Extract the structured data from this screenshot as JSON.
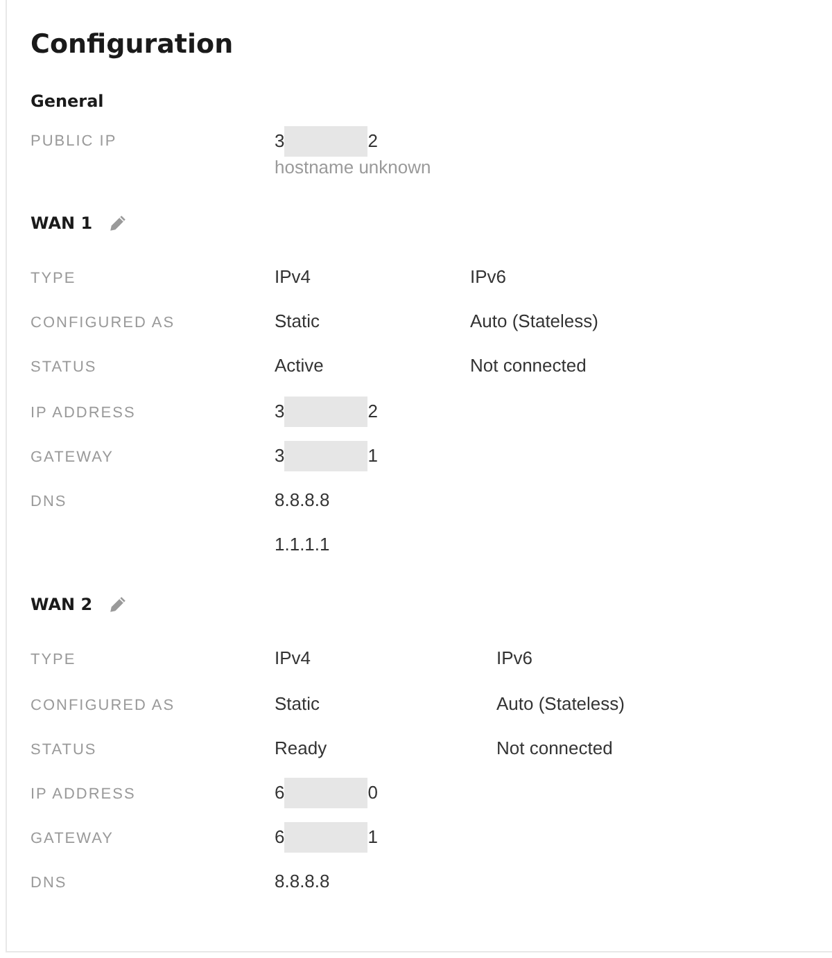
{
  "title": "Configuration",
  "general": {
    "heading": "General",
    "rows": [
      {
        "label": "PUBLIC IP",
        "cells": [
          {
            "kind": "redacted",
            "start": "3",
            "end": "2"
          }
        ],
        "note": "hostname unknown"
      }
    ]
  },
  "wans": [
    {
      "heading": "WAN 1",
      "rows": [
        {
          "label": "TYPE",
          "cells": [
            {
              "kind": "text",
              "text": "IPv4"
            },
            {
              "kind": "text",
              "text": "IPv6"
            }
          ]
        },
        {
          "label": "CONFIGURED AS",
          "cells": [
            {
              "kind": "text",
              "text": "Static"
            },
            {
              "kind": "text",
              "text": "Auto (Stateless)"
            }
          ]
        },
        {
          "label": "STATUS",
          "cells": [
            {
              "kind": "text",
              "text": "Active"
            },
            {
              "kind": "text",
              "text": "Not connected"
            }
          ]
        },
        {
          "label": "IP ADDRESS",
          "cells": [
            {
              "kind": "redacted",
              "start": "3",
              "end": "2"
            }
          ]
        },
        {
          "label": "GATEWAY",
          "cells": [
            {
              "kind": "redacted",
              "start": "3",
              "end": "1"
            }
          ]
        },
        {
          "label": "DNS",
          "cells": [
            {
              "kind": "text",
              "text": "8.8.8.8"
            }
          ]
        },
        {
          "cells": [
            {
              "kind": "text",
              "text": "1.1.1.1"
            }
          ]
        }
      ]
    },
    {
      "heading": "WAN 2",
      "rows": [
        {
          "label": "TYPE",
          "cells": [
            {
              "kind": "text",
              "text": "IPv4"
            },
            {
              "kind": "text",
              "text": "IPv6"
            }
          ]
        },
        {
          "label": "CONFIGURED AS",
          "cells": [
            {
              "kind": "text",
              "text": "Static"
            },
            {
              "kind": "text",
              "text": "Auto (Stateless)"
            }
          ]
        },
        {
          "label": "STATUS",
          "cells": [
            {
              "kind": "text",
              "text": "Ready"
            },
            {
              "kind": "text",
              "text": "Not connected"
            }
          ]
        },
        {
          "label": "IP ADDRESS",
          "cells": [
            {
              "kind": "redacted",
              "start": "6",
              "end": "0"
            }
          ]
        },
        {
          "label": "GATEWAY",
          "cells": [
            {
              "kind": "redacted",
              "start": "6",
              "end": "1"
            }
          ]
        },
        {
          "label": "DNS",
          "cells": [
            {
              "kind": "text",
              "text": "8.8.8.8"
            }
          ]
        }
      ]
    }
  ]
}
